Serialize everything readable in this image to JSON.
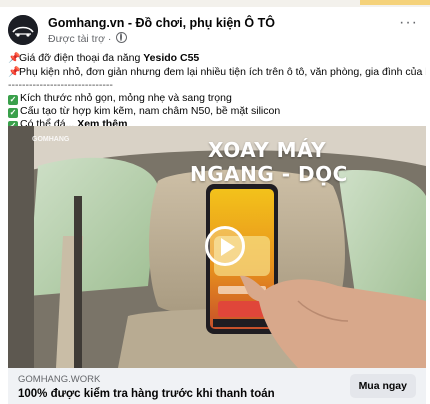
{
  "post": {
    "page_name": "Gomhang.vn - Đồ chơi, phụ kiện Ô TÔ",
    "sponsored_label": "Được tài trợ ·",
    "more_icon": "more-dots-icon",
    "lines": {
      "l1_prefix": "Giá đỡ điện thoại đa năng ",
      "l1_bold": "Yesido C55",
      "l2": "Phụ kiện nhỏ, đơn giản nhưng đem lại nhiều tiện ích trên ô tô, văn phòng, gia đình của bạn...",
      "l3": "------------------------------",
      "l4": "Kích thước nhỏ gọn, mỏng nhẹ và sang trọng",
      "l5": "Cấu tạo từ hợp kim kẽm, nam châm N50, bề mặt silicon",
      "l6": "Có thể đá...",
      "see_more": "Xem thêm"
    }
  },
  "media": {
    "overlay_line1": "XOAY MÁY",
    "overlay_line2": "NGANG - DỌC",
    "watermark": "GOMHANG",
    "play_icon": "play-icon"
  },
  "link_card": {
    "domain": "GOMHANG.WORK",
    "headline": "100% được kiểm tra hàng trước khi thanh toán",
    "cta_label": "Mua ngay"
  },
  "colors": {
    "check_green": "#3aa04b",
    "text": "#050505",
    "secondary": "#65676b",
    "footer_bg": "#f0f2f5"
  }
}
